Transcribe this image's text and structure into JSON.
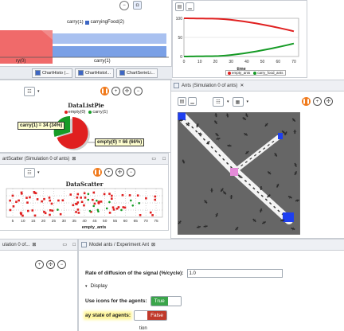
{
  "top_left_chart": {
    "legend_item": "carryingFood(2)",
    "legend_partial": "carry(1)",
    "x_labels": [
      "ry(0)",
      "carry(1)"
    ]
  },
  "top_right_chart": {
    "y_ticks": [
      "100",
      "50",
      "0"
    ],
    "x_ticks": [
      "0",
      "10",
      "20",
      "30",
      "40",
      "50",
      "60",
      "70"
    ],
    "xlabel": "time",
    "legend": [
      {
        "name": "empty_ants",
        "color": "#e02020"
      },
      {
        "name": "carry_food_ants",
        "color": "#169b26"
      }
    ]
  },
  "tabs_row": {
    "tabs": [
      "ChartHisto (...",
      "ChartHistoI...",
      "ChartSerieLi..."
    ]
  },
  "pie": {
    "title": "DataListPie",
    "legend": [
      {
        "name": "empty(0)",
        "color": "#e02020"
      },
      {
        "name": "carry(1)",
        "color": "#169b26"
      }
    ],
    "label_carry": "carry(1) = 34 (34%)",
    "label_empty": "empty(0) = 66 (66%)"
  },
  "scatter": {
    "window_title": "artScatter (Simulation 0 of ants)",
    "title": "DataScatter",
    "x_ticks": [
      "5",
      "10",
      "15",
      "20",
      "25",
      "30",
      "35",
      "40",
      "45",
      "50",
      "55",
      "60",
      "65",
      "70",
      "75"
    ],
    "xlabel": "empty_ants"
  },
  "ants_window": {
    "title": "Ants (Simulation 0 of ants)",
    "close": "✕"
  },
  "bottom_left": {
    "tab": "ulation 0 of..."
  },
  "params": {
    "tab": "Model ants / Experiment Ant",
    "diffusion_label": "Rate of diffusion of the signal (%/cycle):",
    "diffusion_value": "1.0",
    "section": "Display",
    "icons_label": "Use icons for the agents:",
    "icons_value": "True",
    "state_label": "ay state of agents:",
    "state_value": "False",
    "partial": "tion"
  },
  "colors": {
    "red": "#e02020",
    "green": "#169b26",
    "orange": "#f07a1c",
    "blue": "#3d66c4",
    "grid_bg": "#666666"
  }
}
